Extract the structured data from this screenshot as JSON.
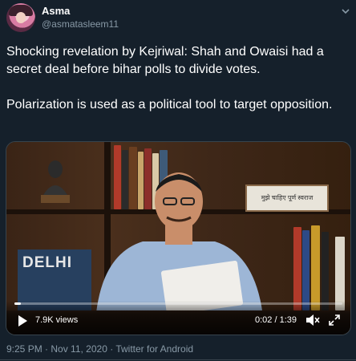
{
  "author": {
    "name": "Asma",
    "handle": "@asmatasleem11"
  },
  "tweet": {
    "paragraphs": [
      "Shocking revelation by Kejriwal: Shah and Owaisi had a secret deal before bihar polls to divide votes.",
      "Polarization is used as a political tool to target opposition."
    ]
  },
  "video": {
    "views": "7.9K views",
    "time": "0:02 / 1:39",
    "progress": 0.02,
    "book_title": "DELHI",
    "sign_text": "मुझे चाहिए पूर्ण स्वराज"
  },
  "meta": {
    "time": "9:25 PM",
    "separator": " · ",
    "date": "Nov 11, 2020",
    "separator2": " · ",
    "source": "Twitter for Android"
  },
  "colors": {
    "background": "#15202b",
    "secondary_text": "#8899a6",
    "border": "#38444d"
  }
}
